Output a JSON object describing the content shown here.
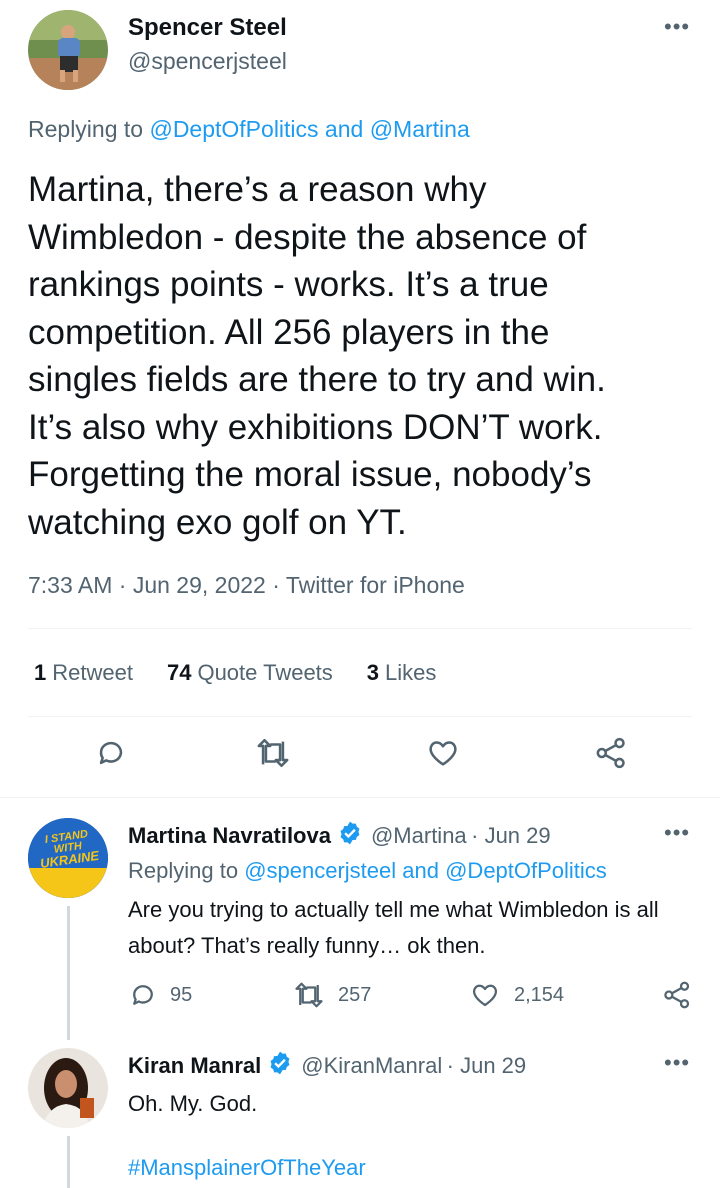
{
  "main_tweet": {
    "author_name": "Spencer Steel",
    "author_handle": "@spencerjsteel",
    "more_label": "•••",
    "replying_prefix": "Replying to ",
    "replying_handle_1": "@DeptOfPolitics",
    "replying_and": " and ",
    "replying_handle_2": "@Martina",
    "text": "Martina, there’s a reason why\nWimbledon - despite the absence of\nrankings points - works. It’s a true\ncompetition. All 256 players in the\nsingles fields are there to try and win.\nIt’s also why exhibitions DON’T work.\nForgetting the moral issue, nobody’s\nwatching exo golf on YT.",
    "timestamp": "7:33 AM · Jun 29, 2022 · Twitter for iPhone",
    "retweets_count": "1",
    "retweets_label": "Retweet",
    "quotes_count": "74",
    "quotes_label": "Quote Tweets",
    "likes_count": "3",
    "likes_label": "Likes"
  },
  "replies": [
    {
      "author_name": "Martina Navratilova",
      "author_handle": "@Martina",
      "date": "· Jun 29",
      "more_label": "•••",
      "avatar_text_1": "I STAND",
      "avatar_text_2": "WITH",
      "avatar_text_3": "UKRAINE",
      "replying_prefix": "Replying to ",
      "replying_handle_1": "@spencerjsteel",
      "replying_and": " and ",
      "replying_handle_2": "@DeptOfPolitics",
      "text": "Are you trying to actually tell me what Wimbledon is all about? That’s really funny… ok then.",
      "reply_count": "95",
      "retweet_count": "257",
      "like_count": "2,154"
    },
    {
      "author_name": "Kiran Manral",
      "author_handle": "@KiranManral",
      "date": "· Jun 29",
      "more_label": "•••",
      "text": "Oh. My. God.",
      "hashtag": "#MansplainerOfTheYear"
    }
  ],
  "colors": {
    "accent": "#1d9bf0",
    "secondary_text": "#536471",
    "primary_text": "#0f1419",
    "divider": "#eff3f4"
  }
}
